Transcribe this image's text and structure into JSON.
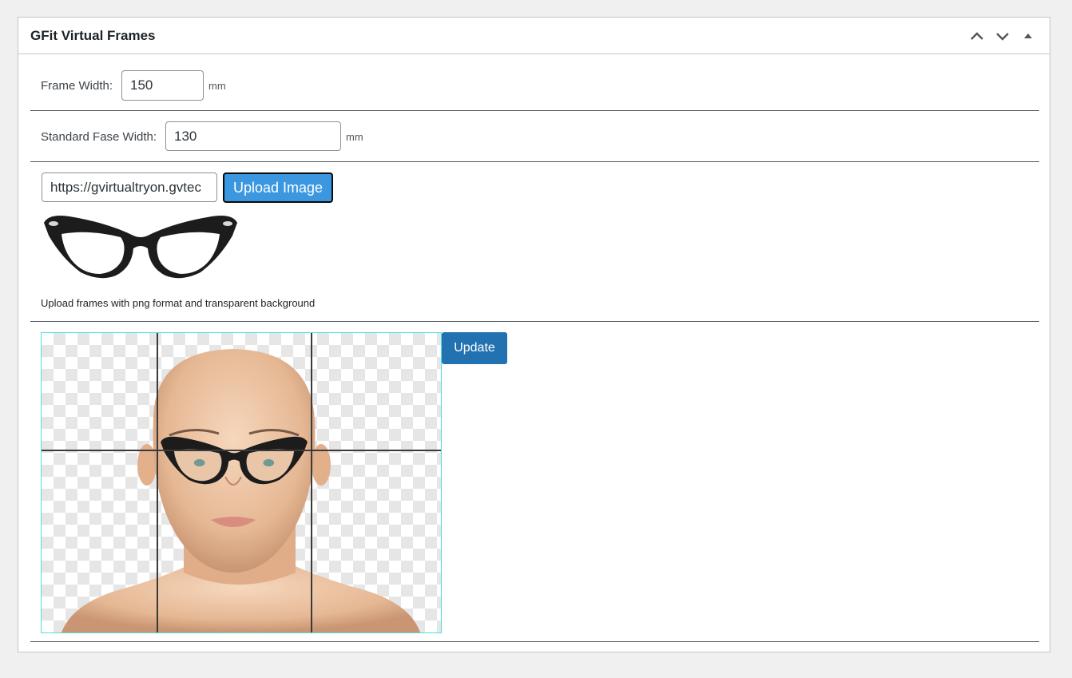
{
  "metabox": {
    "title": "GFit Virtual Frames",
    "actions": [
      {
        "name": "move-up",
        "icon": "chevron-up-icon"
      },
      {
        "name": "move-down",
        "icon": "chevron-down-icon"
      },
      {
        "name": "toggle-panel",
        "icon": "triangle-up-icon"
      }
    ]
  },
  "frame_width": {
    "label": "Frame Width:",
    "value": "150",
    "unit": "mm"
  },
  "face_width": {
    "label": "Standard Fase Width:",
    "value": "130",
    "unit": "mm"
  },
  "upload": {
    "url_value": "https://gvirtualtryon.gvtec",
    "button_label": "Upload Image",
    "help_text": "Upload frames with png format and transparent background"
  },
  "preview": {
    "update_label": "Update"
  },
  "colors": {
    "upload_button": "#3a97e0",
    "update_button": "#2271b1",
    "preview_border": "#4fe0e0",
    "divider": "#50575e"
  }
}
